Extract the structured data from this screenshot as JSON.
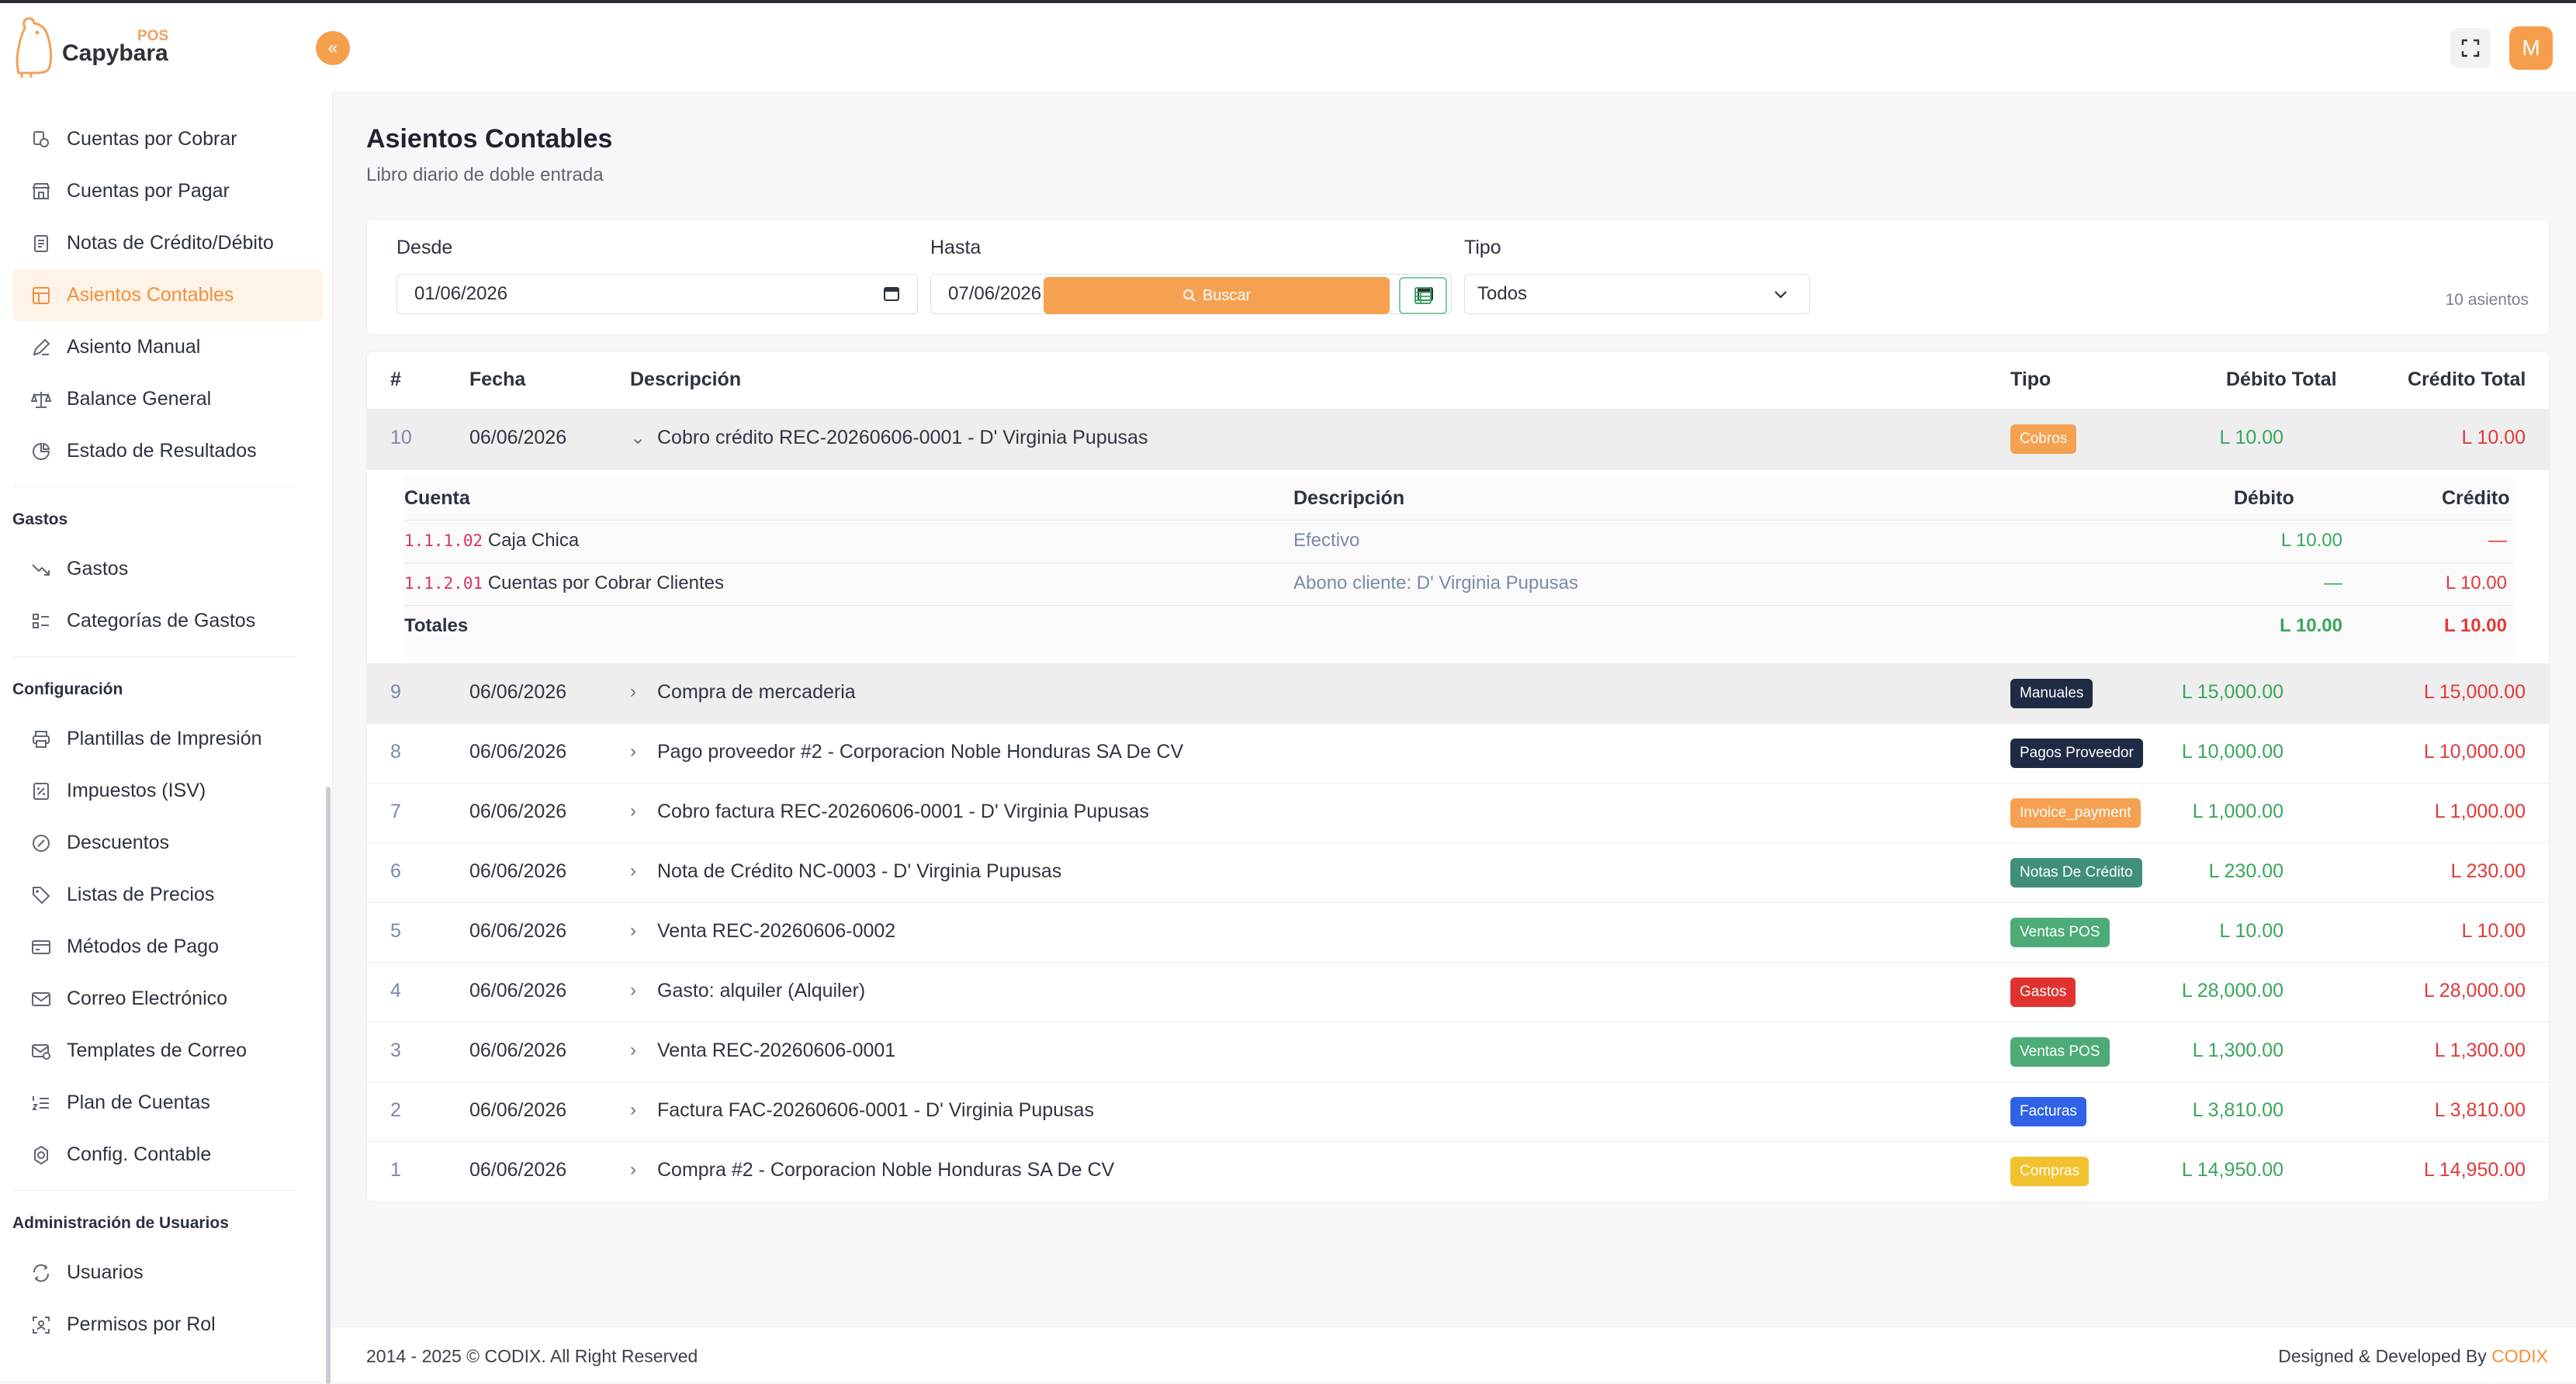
{
  "app": {
    "logo_word": "Capybara",
    "logo_badge": "POS"
  },
  "colors": {
    "accent": "#f59f4d",
    "debit": "#3aa65c",
    "credit": "#e23a3a"
  },
  "sidebar": {
    "top_items": [
      {
        "label": "Cuentas por Cobrar",
        "icon": "receivable-icon"
      },
      {
        "label": "Cuentas por Pagar",
        "icon": "store-icon"
      },
      {
        "label": "Notas de Crédito/Débito",
        "icon": "note-icon"
      },
      {
        "label": "Asientos Contables",
        "icon": "ledger-icon",
        "active": true
      },
      {
        "label": "Asiento Manual",
        "icon": "pen-icon"
      },
      {
        "label": "Balance General",
        "icon": "scale-icon"
      },
      {
        "label": "Estado de Resultados",
        "icon": "pie-icon"
      }
    ],
    "sections": [
      {
        "title": "Gastos",
        "items": [
          {
            "label": "Gastos",
            "icon": "trend-down-icon"
          },
          {
            "label": "Categorías de Gastos",
            "icon": "list-icon"
          }
        ]
      },
      {
        "title": "Configuración",
        "items": [
          {
            "label": "Plantillas de Impresión",
            "icon": "printer-icon"
          },
          {
            "label": "Impuestos (ISV)",
            "icon": "tax-icon"
          },
          {
            "label": "Descuentos",
            "icon": "discount-icon"
          },
          {
            "label": "Listas de Precios",
            "icon": "tag-icon"
          },
          {
            "label": "Métodos de Pago",
            "icon": "card-icon"
          },
          {
            "label": "Correo Electrónico",
            "icon": "mail-icon"
          },
          {
            "label": "Templates de Correo",
            "icon": "mail-template-icon"
          },
          {
            "label": "Plan de Cuentas",
            "icon": "list-numbered-icon"
          },
          {
            "label": "Config. Contable",
            "icon": "settings-icon"
          }
        ]
      },
      {
        "title": "Administración de Usuarios",
        "items": [
          {
            "label": "Usuarios",
            "icon": "users-icon"
          },
          {
            "label": "Permisos por Rol",
            "icon": "role-icon"
          }
        ]
      }
    ]
  },
  "header": {
    "avatar_letter": "M"
  },
  "page": {
    "title": "Asientos Contables",
    "subtitle": "Libro diario de doble entrada"
  },
  "filters": {
    "desde_label": "Desde",
    "desde_value": "01/06/2026",
    "hasta_label": "Hasta",
    "hasta_value": "07/06/2026",
    "tipo_label": "Tipo",
    "tipo_value": "Todos",
    "search_label": "Buscar",
    "count_text": "10 asientos"
  },
  "table": {
    "headers": {
      "num": "#",
      "fecha": "Fecha",
      "descripcion": "Descripción",
      "tipo": "Tipo",
      "debito": "Débito Total",
      "credito": "Crédito Total"
    },
    "rows": [
      {
        "num": "10",
        "fecha": "06/06/2026",
        "desc": "Cobro crédito REC-20260606-0001 - D' Virginia Pupusas",
        "tipo": "Cobros",
        "badge_color": "#f5a151",
        "debito": "L 10.00",
        "credito": "L 10.00",
        "expanded": true
      },
      {
        "num": "9",
        "fecha": "06/06/2026",
        "desc": "Compra de mercaderia",
        "tipo": "Manuales",
        "badge_color": "#1f2a44",
        "debito": "L 15,000.00",
        "credito": "L 15,000.00",
        "shade": true
      },
      {
        "num": "8",
        "fecha": "06/06/2026",
        "desc": "Pago proveedor #2 - Corporacion Noble Honduras SA De CV",
        "tipo": "Pagos Proveedor",
        "badge_color": "#1f2a44",
        "debito": "L 10,000.00",
        "credito": "L 10,000.00"
      },
      {
        "num": "7",
        "fecha": "06/06/2026",
        "desc": "Cobro factura REC-20260606-0001 - D' Virginia Pupusas",
        "tipo": "Invoice_payment",
        "badge_color": "#f5a151",
        "debito": "L 1,000.00",
        "credito": "L 1,000.00"
      },
      {
        "num": "6",
        "fecha": "06/06/2026",
        "desc": "Nota de Crédito NC-0003 - D' Virginia Pupusas",
        "tipo": "Notas De Crédito",
        "badge_color": "#3f8f7a",
        "debito": "L 230.00",
        "credito": "L 230.00"
      },
      {
        "num": "5",
        "fecha": "06/06/2026",
        "desc": "Venta REC-20260606-0002",
        "tipo": "Ventas POS",
        "badge_color": "#4dab77",
        "debito": "L 10.00",
        "credito": "L 10.00"
      },
      {
        "num": "4",
        "fecha": "06/06/2026",
        "desc": "Gasto: alquiler (Alquiler)",
        "tipo": "Gastos",
        "badge_color": "#e0332f",
        "debito": "L 28,000.00",
        "credito": "L 28,000.00"
      },
      {
        "num": "3",
        "fecha": "06/06/2026",
        "desc": "Venta REC-20260606-0001",
        "tipo": "Ventas POS",
        "badge_color": "#4dab77",
        "debito": "L 1,300.00",
        "credito": "L 1,300.00"
      },
      {
        "num": "2",
        "fecha": "06/06/2026",
        "desc": "Factura FAC-20260606-0001 - D' Virginia Pupusas",
        "tipo": "Facturas",
        "badge_color": "#2f62e6",
        "debito": "L 3,810.00",
        "credito": "L 3,810.00"
      },
      {
        "num": "1",
        "fecha": "06/06/2026",
        "desc": "Compra #2 - Corporacion Noble Honduras SA De CV",
        "tipo": "Compras",
        "badge_color": "#f2c12e",
        "debito": "L 14,950.00",
        "credito": "L 14,950.00"
      }
    ],
    "detail": {
      "headers": {
        "cuenta": "Cuenta",
        "descripcion": "Descripción",
        "debito": "Débito",
        "credito": "Crédito"
      },
      "lines": [
        {
          "code": "1.1.1.02",
          "account": "Caja Chica",
          "desc": "Efectivo",
          "debito": "L 10.00",
          "credito": "—"
        },
        {
          "code": "1.1.2.01",
          "account": "Cuentas por Cobrar Clientes",
          "desc": "Abono cliente: D' Virginia Pupusas",
          "debito": "—",
          "credito": "L 10.00"
        }
      ],
      "totals_label": "Totales",
      "total_debito": "L 10.00",
      "total_credito": "L 10.00"
    }
  },
  "footer": {
    "left": "2014 - 2025 © CODIX. All Right Reserved",
    "right_prefix": "Designed & Developed By ",
    "right_brand": "CODIX"
  }
}
